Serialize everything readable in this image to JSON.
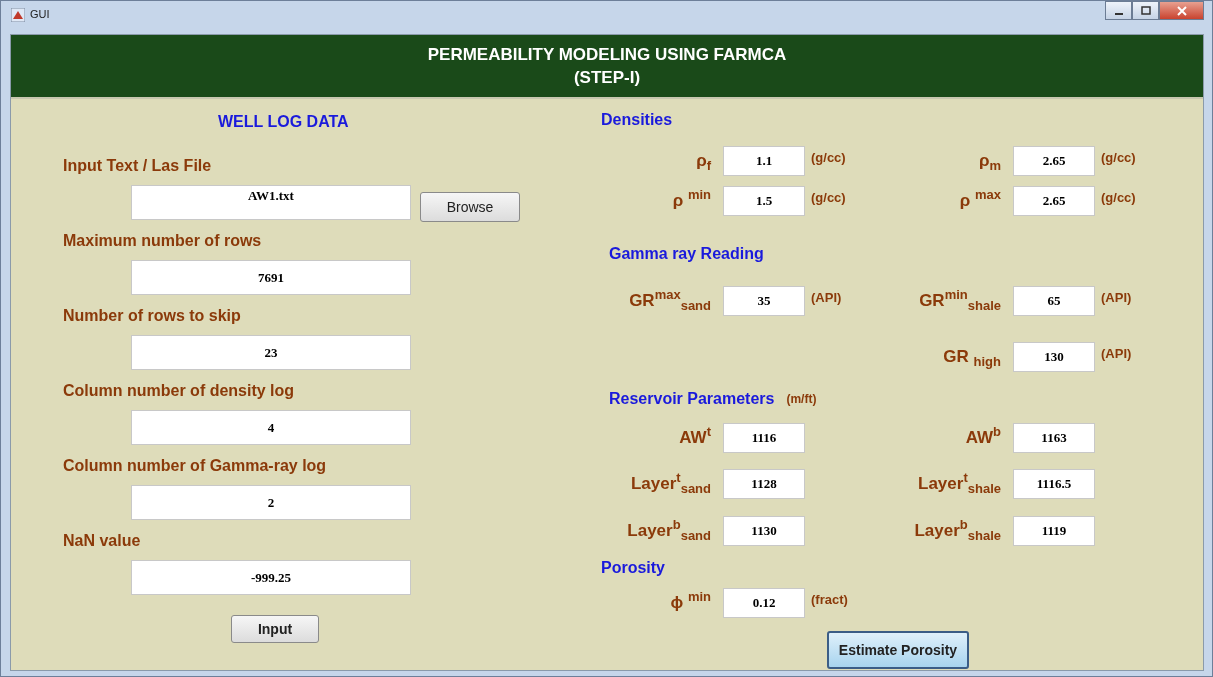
{
  "window": {
    "title": "GUI"
  },
  "header": {
    "title": "PERMEABILITY MODELING USING FARMCA",
    "subtitle": "(STEP-I)"
  },
  "well_log": {
    "heading": "WELL LOG DATA",
    "fields": [
      {
        "label": "Input Text / Las File",
        "value": "AW1.txt",
        "browse": "Browse"
      },
      {
        "label": "Maximum number of rows",
        "value": "7691"
      },
      {
        "label": "Number of rows to skip",
        "value": "23"
      },
      {
        "label": "Column number of density log",
        "value": "4"
      },
      {
        "label": "Column number of Gamma-ray log",
        "value": "2"
      },
      {
        "label": "NaN value",
        "value": "-999.25"
      }
    ],
    "button": "Input"
  },
  "sections": [
    {
      "heading": "Densities",
      "rows": [
        {
          "left": {
            "label": "ρ$_{f}$",
            "value": "1.1",
            "unit": "(g/cc)"
          },
          "right": {
            "label": "ρ$_{m}$",
            "value": "2.65",
            "unit": "(g/cc)"
          }
        },
        {
          "left": {
            "label": "ρ $^{min}$",
            "value": "1.5",
            "unit": "(g/cc)"
          },
          "right": {
            "label": "ρ $^{max}$",
            "value": "2.65",
            "unit": "(g/cc)"
          }
        }
      ]
    },
    {
      "heading": "Gamma ray Reading",
      "rows": [
        {
          "left": {
            "label": "GR$^{max}$$_{sand}$",
            "value": "35",
            "unit": "(API)"
          },
          "right": {
            "label": "GR$^{min}$$_{shale}$",
            "value": "65",
            "unit": "(API)"
          }
        },
        {
          "right": {
            "label": "GR $_{high}$",
            "value": "130",
            "unit": "(API)"
          }
        }
      ]
    },
    {
      "heading": "Reservoir Parameters",
      "note": "(m/ft)",
      "rows": [
        {
          "left": {
            "label": "AW$^{t}$",
            "value": "1116"
          },
          "right": {
            "label": "AW$^{b}$",
            "value": "1163"
          }
        },
        {
          "left": {
            "label": "Layer$^{t}$$_{sand}$",
            "value": "1128"
          },
          "right": {
            "label": "Layer$^{t}$$_{shale}$",
            "value": "1116.5"
          }
        },
        {
          "left": {
            "label": "Layer$^{b}$$_{sand}$",
            "value": "1130"
          },
          "right": {
            "label": "Layer$^{b}$$_{shale}$",
            "value": "1119"
          }
        }
      ]
    },
    {
      "heading": "Porosity",
      "rows": [
        {
          "left": {
            "label": "ϕ $^{min}$",
            "value": "0.12",
            "unit": "(fract)"
          }
        }
      ]
    }
  ],
  "estimate_button": "Estimate Porosity"
}
